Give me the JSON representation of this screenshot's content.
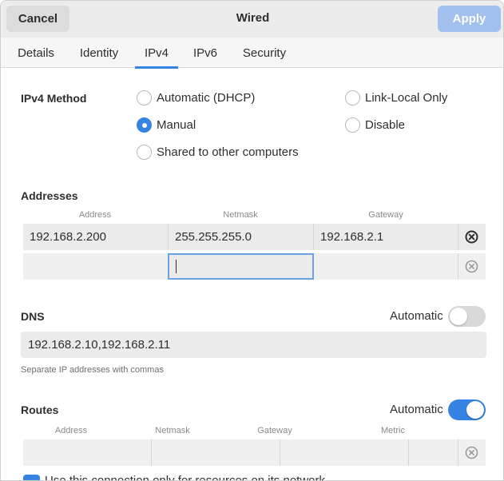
{
  "header": {
    "cancel_label": "Cancel",
    "title": "Wired",
    "apply_label": "Apply"
  },
  "tabs": [
    {
      "label": "Details",
      "active": false
    },
    {
      "label": "Identity",
      "active": false
    },
    {
      "label": "IPv4",
      "active": true
    },
    {
      "label": "IPv6",
      "active": false
    },
    {
      "label": "Security",
      "active": false
    }
  ],
  "ipv4_method": {
    "label": "IPv4 Method",
    "options": [
      {
        "label": "Automatic (DHCP)",
        "checked": false
      },
      {
        "label": "Manual",
        "checked": true
      },
      {
        "label": "Shared to other computers",
        "checked": false
      },
      {
        "label": "Link-Local Only",
        "checked": false
      },
      {
        "label": "Disable",
        "checked": false
      }
    ]
  },
  "addresses": {
    "label": "Addresses",
    "columns": [
      "Address",
      "Netmask",
      "Gateway"
    ],
    "rows": [
      {
        "address": "192.168.2.200",
        "netmask": "255.255.255.0",
        "gateway": "192.168.2.1"
      },
      {
        "address": "",
        "netmask": "",
        "gateway": ""
      }
    ]
  },
  "dns": {
    "label": "DNS",
    "automatic_label": "Automatic",
    "automatic": false,
    "value": "192.168.2.10,192.168.2.11",
    "hint": "Separate IP addresses with commas"
  },
  "routes": {
    "label": "Routes",
    "automatic_label": "Automatic",
    "automatic": true,
    "columns": [
      "Address",
      "Netmask",
      "Gateway",
      "Metric"
    ]
  },
  "bottom_checkbox": {
    "label": "Use this connection only for resources on its network",
    "checked": true
  },
  "colors": {
    "accent": "#3584e4",
    "apply_disabled": "#a2c0ee"
  }
}
